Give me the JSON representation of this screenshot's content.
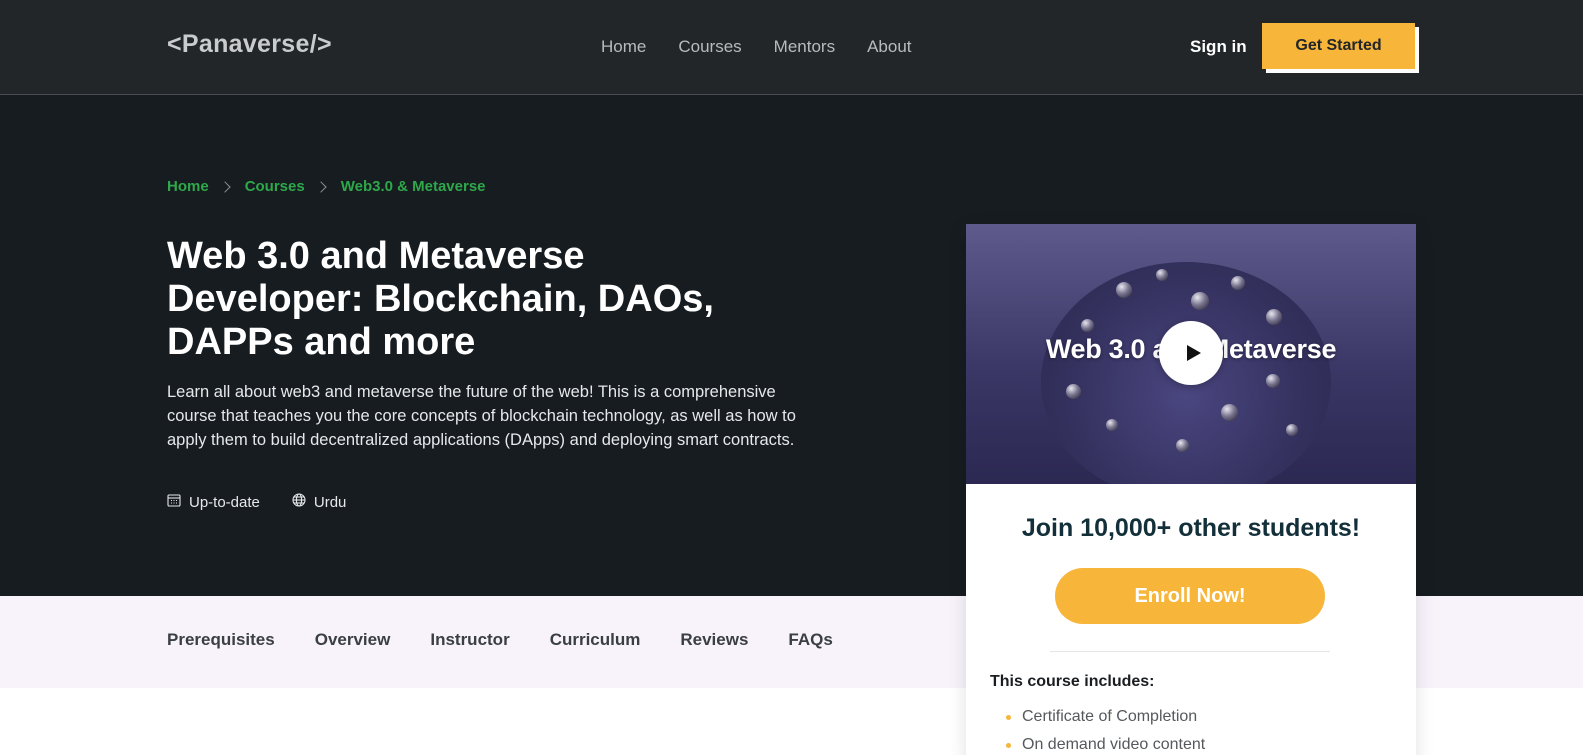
{
  "header": {
    "logo": "<Panaverse/>",
    "nav": [
      "Home",
      "Courses",
      "Mentors",
      "About"
    ],
    "signin_label": "Sign in",
    "cta_label": "Get Started"
  },
  "breadcrumb": [
    "Home",
    "Courses",
    "Web3.0 & Metaverse"
  ],
  "hero": {
    "title": "Web 3.0 and Metaverse Developer: Blockchain, DAOs, DAPPs and more",
    "description": "Learn all about web3 and metaverse the future of the web! This is a comprehensive course that teaches you the core concepts of blockchain technology, as well as how to apply them to build decentralized applications (DApps) and deploying smart contracts.",
    "meta": [
      {
        "icon": "calendar-icon",
        "label": "Up-to-date"
      },
      {
        "icon": "globe-icon",
        "label": "Urdu"
      }
    ]
  },
  "tabs": [
    "Prerequisites",
    "Overview",
    "Instructor",
    "Curriculum",
    "Reviews",
    "FAQs"
  ],
  "card": {
    "video_title": "Web 3.0 and Metaverse",
    "join_text": "Join 10,000+ other students!",
    "enroll_label": "Enroll Now!",
    "includes_title": "This course includes:",
    "includes": [
      "Certificate of Completion",
      "On demand video content"
    ]
  },
  "colors": {
    "accent": "#f7b53a",
    "breadcrumb": "#2ea84a",
    "header_bg": "#222629",
    "hero_bg": "#161c20",
    "tabs_bg": "#f8f2fb"
  }
}
